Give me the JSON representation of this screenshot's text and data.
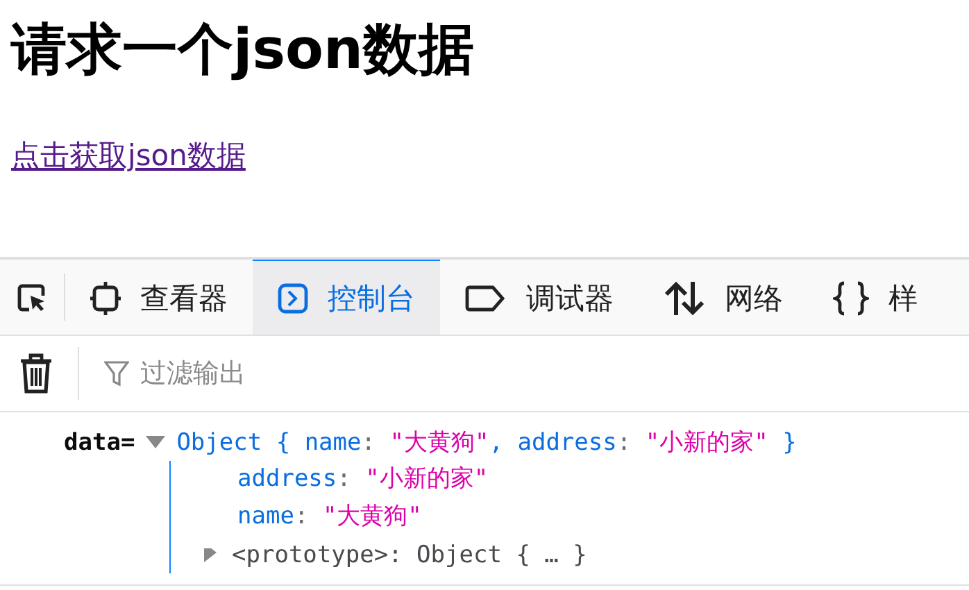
{
  "page": {
    "heading": "请求一个json数据",
    "link": "点击获取json数据"
  },
  "devtools": {
    "tabs": [
      {
        "kind": "picker",
        "selected": false
      },
      {
        "kind": "inspector",
        "label": "查看器",
        "selected": false
      },
      {
        "kind": "console",
        "label": "控制台",
        "selected": true
      },
      {
        "kind": "debugger",
        "label": "调试器",
        "selected": false
      },
      {
        "kind": "network",
        "label": "网络",
        "selected": false
      },
      {
        "kind": "style",
        "label": "样",
        "selected": false
      }
    ],
    "filter": {
      "placeholder": "过滤输出"
    },
    "log": {
      "label": "data=",
      "expanded": true,
      "summary": [
        {
          "t": "Object { ",
          "kind": "type"
        },
        {
          "t": "name",
          "kind": "key"
        },
        {
          "t": ": ",
          "kind": "punct"
        },
        {
          "t": "\"大黄狗\"",
          "kind": "string"
        },
        {
          "t": ", ",
          "kind": "type"
        },
        {
          "t": "address",
          "kind": "key"
        },
        {
          "t": ": ",
          "kind": "punct"
        },
        {
          "t": "\"小新的家\"",
          "kind": "string"
        },
        {
          "t": " }",
          "kind": "type"
        }
      ],
      "properties": [
        [
          {
            "t": "address",
            "kind": "key"
          },
          {
            "t": ": ",
            "kind": "punct"
          },
          {
            "t": "\"小新的家\"",
            "kind": "string"
          }
        ],
        [
          {
            "t": "name",
            "kind": "key"
          },
          {
            "t": ": ",
            "kind": "punct"
          },
          {
            "t": "\"大黄狗\"",
            "kind": "string"
          }
        ]
      ],
      "prototype": {
        "expanded": false,
        "line": [
          {
            "t": "<prototype>: Object { … }",
            "kind": "grey"
          }
        ]
      }
    }
  }
}
